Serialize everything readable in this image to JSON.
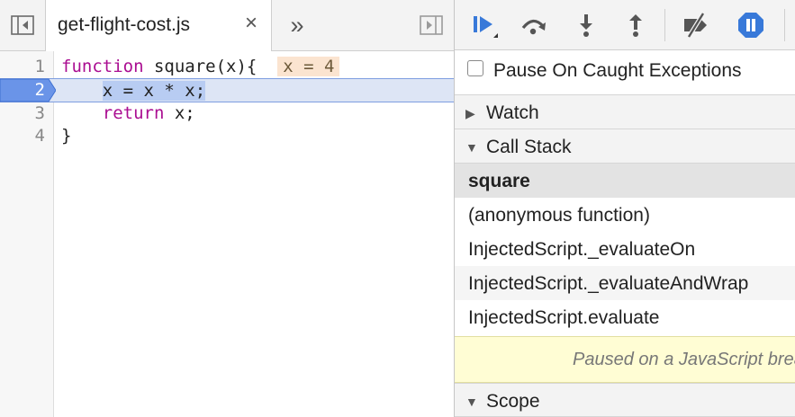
{
  "editor": {
    "tab_label": "get-flight-cost.js",
    "tab_close": "×",
    "overflow": "»",
    "lines": [
      {
        "num": "1",
        "keyword": "function",
        "rest": " square(x){",
        "inline": "x = 4"
      },
      {
        "num": "2",
        "text": "x = x * x;"
      },
      {
        "num": "3",
        "keyword": "return",
        "rest": " x;"
      },
      {
        "num": "4",
        "text": "}"
      }
    ],
    "current_line": "2"
  },
  "debugger": {
    "pause_caught_label": "Pause On Caught Exceptions",
    "sections": {
      "watch": "Watch",
      "call_stack": "Call Stack",
      "scope": "Scope"
    },
    "call_stack": [
      "square",
      "(anonymous function)",
      "InjectedScript._evaluateOn",
      "InjectedScript._evaluateAndWrap",
      "InjectedScript.evaluate"
    ],
    "paused_message": "Paused on a JavaScript breakpoint."
  },
  "colors": {
    "accent": "#3879d9",
    "current_line_bg": "#dde5f5",
    "selected_frame_bg": "#e3e3e3",
    "paused_bg": "#fffdd4"
  },
  "icons": {
    "toggle_navigator": "sidebar-toggle-icon",
    "toggle_debugger": "sidebar-toggle-right-icon",
    "resume": "resume-icon",
    "step_over": "step-over-icon",
    "step_into": "step-into-icon",
    "step_out": "step-out-icon",
    "deactivate": "deactivate-breakpoints-icon",
    "pause_exceptions": "pause-on-exceptions-icon"
  }
}
